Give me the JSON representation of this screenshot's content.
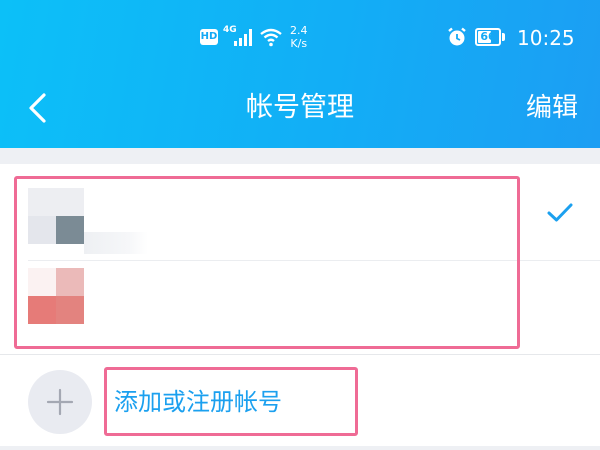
{
  "status_bar": {
    "hd_label": "HD",
    "network_label": "4G",
    "speed_value": "2.4",
    "speed_unit": "K/s",
    "battery_level": "66",
    "battery_fraction": 0.66,
    "time": "10:25",
    "icons": [
      "signal-icon",
      "wifi-icon",
      "alarm-icon",
      "battery-icon"
    ]
  },
  "nav": {
    "back_icon": "chevron-left-icon",
    "title": "帐号管理",
    "edit_label": "编辑"
  },
  "accounts": [
    {
      "selected": true,
      "icon": "check-icon"
    },
    {
      "selected": false
    }
  ],
  "add_account": {
    "icon": "plus-icon",
    "label": "添加或注册帐号"
  },
  "colors": {
    "header_start": "#0cc0f8",
    "header_end": "#1c9ef3",
    "accent": "#1ba0ef",
    "highlight": "#ef6b95",
    "background": "#eef0f4"
  }
}
